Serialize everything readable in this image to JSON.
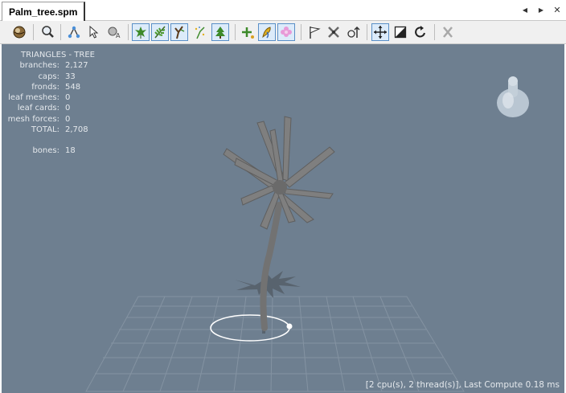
{
  "tab": {
    "title": "Palm_tree.spm"
  },
  "tab_controls": {
    "prev": "◀",
    "next": "▶",
    "close": "✕"
  },
  "toolbar": {
    "buttons": [
      {
        "name": "sphere-render-icon",
        "active": false
      },
      {
        "name": "zoom-view-icon",
        "active": false
      },
      {
        "name": "node-tree-icon",
        "active": false
      },
      {
        "name": "select-cursor-icon",
        "active": false
      },
      {
        "name": "collision-icon",
        "active": false
      },
      {
        "name": "leaf-icon",
        "active": true
      },
      {
        "name": "frond-icon",
        "active": true
      },
      {
        "name": "branch-icon",
        "active": true
      },
      {
        "name": "sparkle-branch-icon",
        "active": false
      },
      {
        "name": "tree-icon",
        "active": true
      },
      {
        "name": "add-node-icon",
        "active": false
      },
      {
        "name": "brush-icon",
        "active": true
      },
      {
        "name": "flower-icon",
        "active": true
      },
      {
        "name": "flag-icon",
        "active": false
      },
      {
        "name": "bones-icon",
        "active": false
      },
      {
        "name": "forces-icon",
        "active": false
      },
      {
        "name": "move-icon",
        "active": true
      },
      {
        "name": "scale-icon",
        "active": false
      },
      {
        "name": "rotate-icon",
        "active": false
      },
      {
        "name": "delete-x-icon",
        "active": false
      }
    ]
  },
  "stats": {
    "header": "TRIANGLES - TREE",
    "rows": [
      {
        "label": "branches:",
        "value": "2,127"
      },
      {
        "label": "caps:",
        "value": "33"
      },
      {
        "label": "fronds:",
        "value": "548"
      },
      {
        "label": "leaf meshes:",
        "value": "0"
      },
      {
        "label": "leaf cards:",
        "value": "0"
      },
      {
        "label": "mesh forces:",
        "value": "0"
      },
      {
        "label": "TOTAL:",
        "value": "2,708"
      }
    ],
    "bones_label": "bones:",
    "bones_value": "18"
  },
  "footer": {
    "text": "[2 cpu(s), 2 thread(s)], Last Compute 0.18 ms"
  },
  "colors": {
    "viewport_bg": "#6e7f90",
    "grid": "#8493a2",
    "tree": "#7d7d7d",
    "shadow": "#58636e",
    "ring": "#ffffff"
  }
}
